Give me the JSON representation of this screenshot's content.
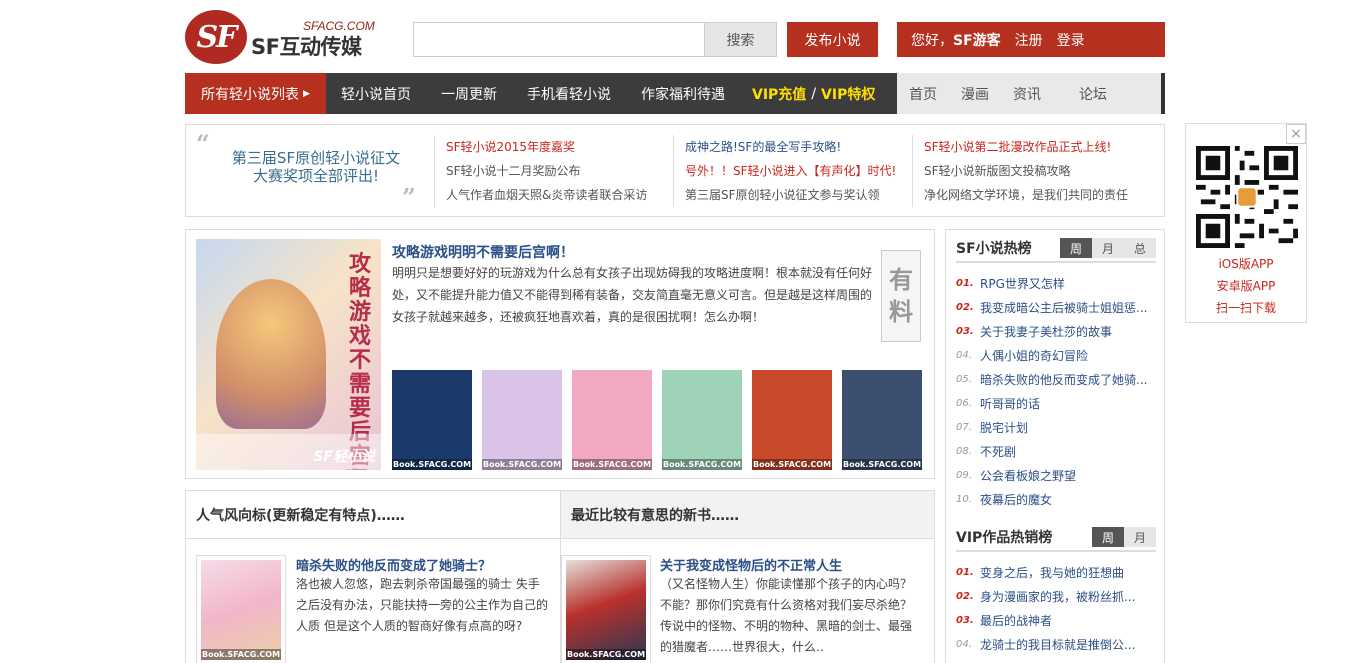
{
  "header": {
    "logo_letters": "SF",
    "logo_domain": "SFACG.COM",
    "logo_name": "SF互动传媒",
    "search_placeholder": "",
    "search_btn": "搜索",
    "publish_btn": "发布小说",
    "greeting": "您好，",
    "guest": "SF游客",
    "register": "注册",
    "login": "登录"
  },
  "nav": {
    "all": "所有轻小说列表",
    "items": [
      "轻小说首页",
      "一周更新",
      "手机看轻小说",
      "作家福利待遇"
    ],
    "vip_recharge": "VIP充值",
    "vip_sep": "/",
    "vip_privilege": "VIP特权",
    "right_items": [
      "首页",
      "漫画",
      "资讯",
      "论坛"
    ]
  },
  "announcement": {
    "featured": "第三届SF原创轻小说征文大赛奖项全部评出!",
    "columns": [
      [
        "SF轻小说2015年度嘉奖",
        "SF轻小说十二月奖励公布",
        "人气作者血烟天照&炎帝读者联合采访"
      ],
      [
        "成神之路!SF的最全写手攻略!",
        "号外！！SF轻小说进入【有声化】时代!",
        "第三届SF原创轻小说征文参与奖认领"
      ],
      [
        "SF轻小说第二批漫改作品正式上线!",
        "SF轻小说新版图文投稿攻略",
        "净化网络文学环境，是我们共同的责任"
      ]
    ]
  },
  "featured": {
    "cover_title": "攻略游戏不需要后宫啊!!",
    "cover_brand": "SF轻小说",
    "title": "攻略游戏明明不需要后宫啊！",
    "desc": "明明只是想要好好的玩游戏为什么总有女孩子出现妨碍我的攻略进度啊！根本就没有任何好处，又不能提升能力值又不能得到稀有装备，交友简直毫无意义可言。但是越是这样周围的女孩子就越来越多，还被疯狂地喜欢着，真的是很困扰啊！怎么办啊！",
    "badge": [
      "有",
      "料"
    ],
    "thumb_label": "Book.SFACG.COM",
    "thumb_colors": [
      "#1b3a6b",
      "#d9c3e6",
      "#f2a7c3",
      "#9fd3b8",
      "#c94a2a",
      "#3d4f6e"
    ]
  },
  "sections": {
    "left_title": "人气风向标(更新稳定有特点)……",
    "right_title": "最近比较有意思的新书……",
    "left_book": {
      "title": "暗杀失败的他反而变成了她骑士？",
      "desc": "洛也被人忽悠，跑去刺杀帝国最强的骑士 失手之后没有办法，只能扶持一旁的公主作为自己的人质 但是这个人质的智商好像有点高的呀?"
    },
    "right_book": {
      "title": "关于我变成怪物后的不正常人生",
      "desc": "（又名怪物人生）你能读懂那个孩子的内心吗？不能？那你们究竟有什么资格对我们妄尽杀绝？传说中的怪物、不明的物种、黑暗的剑士、最强的猎魔者……世界很大，什么.."
    },
    "book_label": "Book.SFACG.COM"
  },
  "rank_hot": {
    "title": "SF小说热榜",
    "tabs": [
      "周",
      "月",
      "总"
    ],
    "items": [
      {
        "n": "01.",
        "t": "RPG世界又怎样"
      },
      {
        "n": "02.",
        "t": "我变成暗公主后被骑士姐姐惩..."
      },
      {
        "n": "03.",
        "t": "关于我妻子美杜莎的故事"
      },
      {
        "n": "04.",
        "t": "人偶小姐的奇幻冒险"
      },
      {
        "n": "05.",
        "t": "暗杀失败的他反而变成了她骑..."
      },
      {
        "n": "06.",
        "t": "听哥哥的话"
      },
      {
        "n": "07.",
        "t": "脱宅计划"
      },
      {
        "n": "08.",
        "t": "不死剧"
      },
      {
        "n": "09.",
        "t": "公会看板娘之野望"
      },
      {
        "n": "10.",
        "t": "夜幕后的魔女"
      }
    ]
  },
  "rank_vip": {
    "title": "VIP作品热销榜",
    "tabs": [
      "周",
      "月"
    ],
    "items": [
      {
        "n": "01.",
        "t": "变身之后，我与她的狂想曲"
      },
      {
        "n": "02.",
        "t": "身为漫画家的我，被粉丝抓..."
      },
      {
        "n": "03.",
        "t": "最后的战神者"
      },
      {
        "n": "04.",
        "t": "龙骑士的我目标就是推倒公..."
      }
    ]
  },
  "qr": {
    "close": "×",
    "ios": "iOS版APP",
    "android": "安卓版APP",
    "scan": "扫一扫下载"
  }
}
